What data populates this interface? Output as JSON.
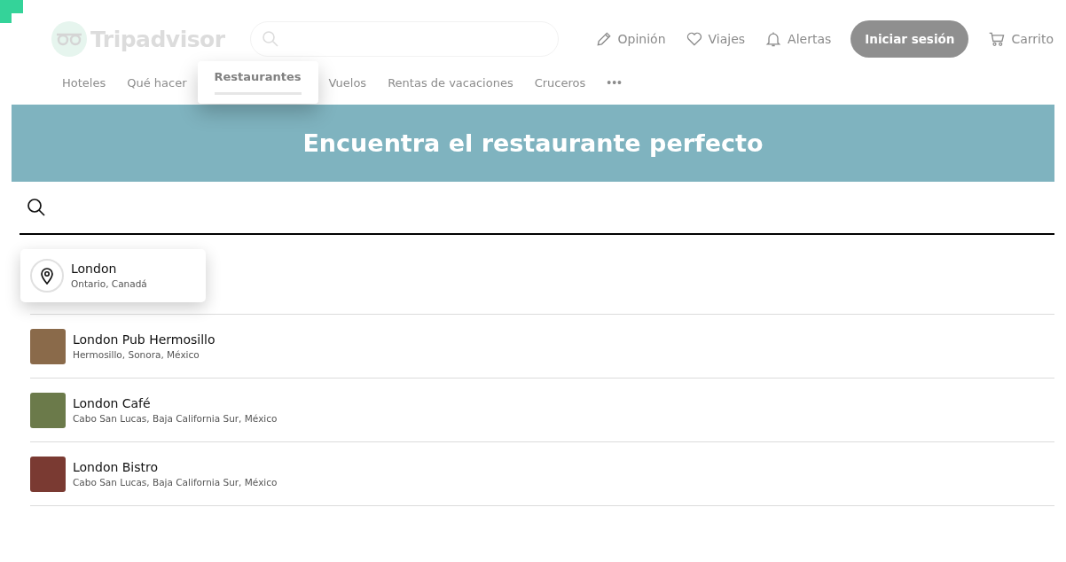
{
  "header": {
    "logo": "Tripadvisor",
    "actions": [
      {
        "kind": "review",
        "label": "Opinión"
      },
      {
        "kind": "trips",
        "label": "Viajes"
      },
      {
        "kind": "alerts",
        "label": "Alertas"
      }
    ],
    "sign_in": "Iniciar sesión",
    "cart": "Carrito"
  },
  "nav": {
    "tabs": [
      {
        "label": "Hoteles",
        "selected": false
      },
      {
        "label": "Qué hacer",
        "selected": false
      },
      {
        "label": "Restaurantes",
        "selected": true
      },
      {
        "label": "Vuelos",
        "selected": false
      },
      {
        "label": "Rentas de vacaciones",
        "selected": false
      },
      {
        "label": "Cruceros",
        "selected": false
      }
    ],
    "more": "•••"
  },
  "hero": {
    "title": "Encuentra el restaurante perfecto"
  },
  "results": [
    {
      "kind": "location",
      "name": "London",
      "detail": "Ontario, Canadá",
      "selected": true
    },
    {
      "kind": "restaurant",
      "name": "London Pub Hermosillo",
      "detail": "Hermosillo, Sonora, México",
      "selected": false
    },
    {
      "kind": "restaurant",
      "name": "London Café",
      "detail": "Cabo San Lucas, Baja California Sur, México",
      "selected": false
    },
    {
      "kind": "restaurant",
      "name": "London Bistro",
      "detail": "Cabo San Lucas, Baja California Sur, México",
      "selected": false
    }
  ]
}
